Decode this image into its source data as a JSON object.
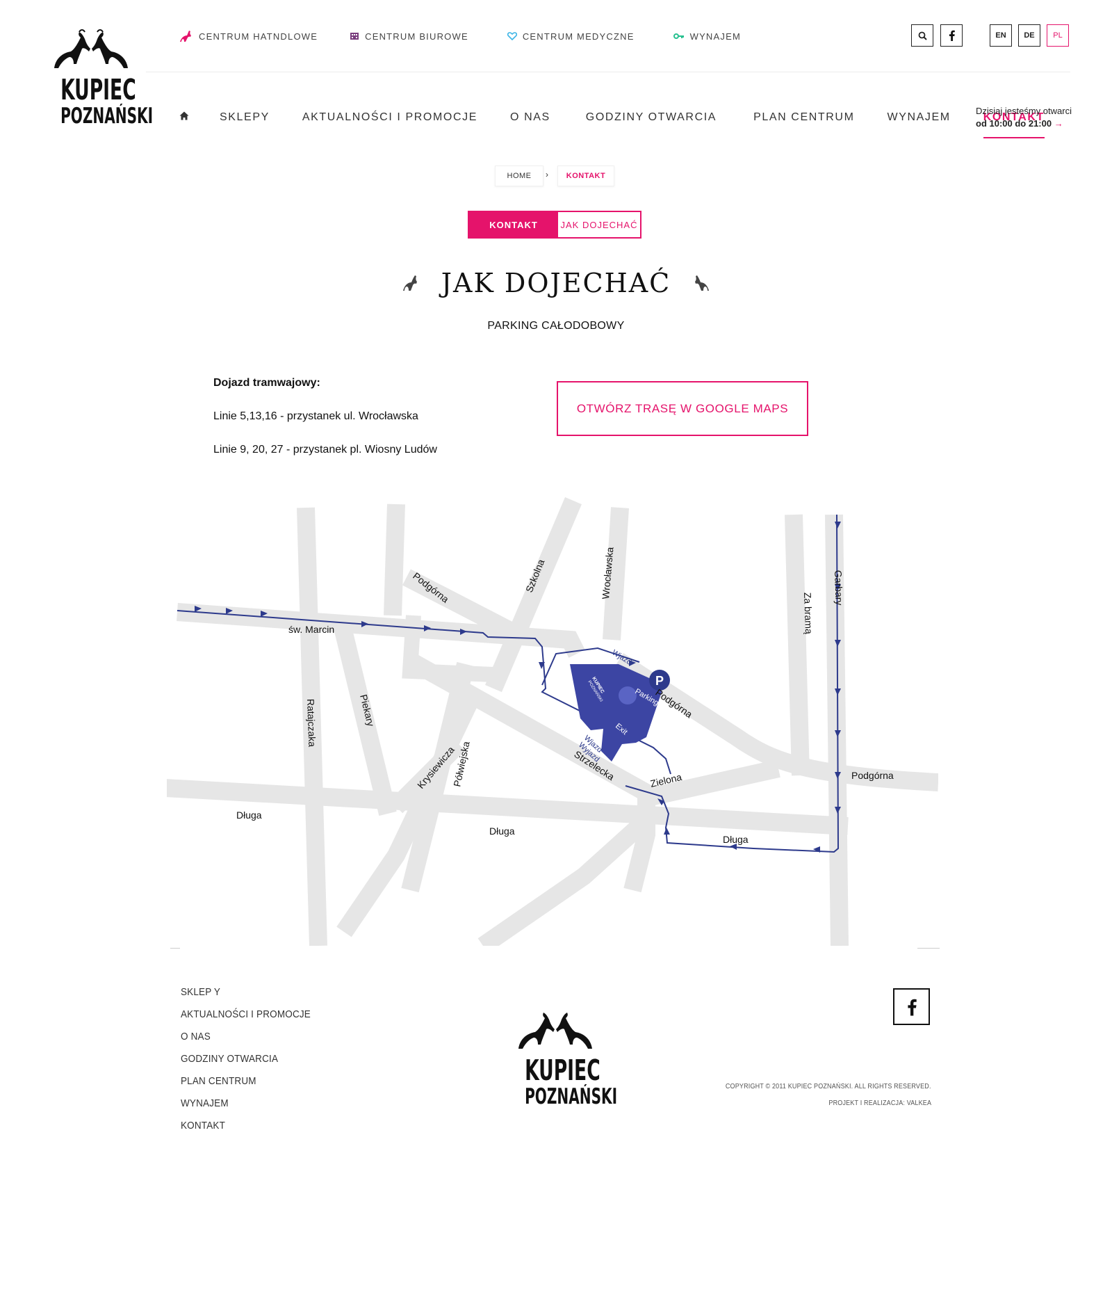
{
  "brand": {
    "line1": "KUPIEC",
    "line2": "POZNAŃSKI"
  },
  "topnav": [
    {
      "label": "CENTRUM HATNDLOWE",
      "icon": "goat-icon",
      "color": "#e5136b"
    },
    {
      "label": "CENTRUM BIUROWE",
      "icon": "building-icon",
      "color": "#7a3d7e"
    },
    {
      "label": "CENTRUM MEDYCZNE",
      "icon": "heart-icon",
      "color": "#3db5e6"
    },
    {
      "label": "WYNAJEM",
      "icon": "key-icon",
      "color": "#27c08f"
    }
  ],
  "languages": [
    "EN",
    "DE",
    "PL"
  ],
  "active_language": "PL",
  "mainnav": {
    "home_icon": "home-icon",
    "items": [
      "SKLEPY",
      "AKTUALNOŚCI I PROMOCJE",
      "O NAS",
      "GODZINY OTWARCIA",
      "PLAN CENTRUM",
      "WYNAJEM",
      "KONTAKT"
    ],
    "active": "KONTAKT"
  },
  "opening": {
    "line1": "Dzisiaj jesteśmy otwarci",
    "line2": "od 10:00 do 21:00",
    "arrow": "→"
  },
  "breadcrumb": {
    "home": "HOME",
    "separator": "›",
    "current": "KONTAKT"
  },
  "tabs": {
    "active": "KONTAKT",
    "other": "JAK DOJECHAĆ"
  },
  "page": {
    "title": "JAK DOJECHAĆ",
    "subtitle": "PARKING CAŁODOBOWY",
    "tram_heading": "Dojazd tramwajowy:",
    "tram_line1": "Linie 5,13,16 - przystanek ul. Wrocławska",
    "tram_line2": "Linie 9, 20, 27 - przystanek pl. Wiosny Ludów",
    "maps_button": "OTWÓRZ TRASĘ W GOOGLE MAPS"
  },
  "map": {
    "streets": {
      "swmarcin": "św. Marcin",
      "podgorna1": "Podgórna",
      "szkolna": "Szkolna",
      "wroclawska": "Wrocławska",
      "zabrama": "Za bramą",
      "garbary": "Garbary",
      "podgorna2": "Podgórna",
      "podgorna3": "Podgórna",
      "ratajczaka": "Ratajczaka",
      "piekary": "Piekary",
      "krysiewicza": "Krysiewicza",
      "polwiejska": "Półwiejska",
      "strzelecka": "Strzelecka",
      "zielona": "Zielona",
      "dluga1": "Długa",
      "dluga2": "Długa",
      "dluga3": "Długa"
    },
    "labels": {
      "parking": "Parking",
      "wjazd1": "Wjazd",
      "exit": "Exit",
      "wjazd2": "Wjazd",
      "wyjazd": "Wyjazd",
      "p": "P",
      "building_l1": "KUPIEC",
      "building_l2": "POZNAŃSKI"
    },
    "colors": {
      "road": "#e6e6e6",
      "route": "#2d3a8c",
      "building": "#3c45a3"
    }
  },
  "footer": {
    "nav": [
      "SKLEP Y",
      "AKTUALNOŚCI I PROMOCJE",
      "O NAS",
      "GODZINY OTWARCIA",
      "PLAN CENTRUM",
      "WYNAJEM",
      "KONTAKT"
    ],
    "copyright": "COPYRIGHT © 2011 KUPIEC POZNAŃSKI. ALL RIGHTS RESERVED.",
    "credits": "PROJEKT I REALIZACJA: VALKEA"
  },
  "colors": {
    "accent": "#e5136b",
    "text": "#222222"
  }
}
